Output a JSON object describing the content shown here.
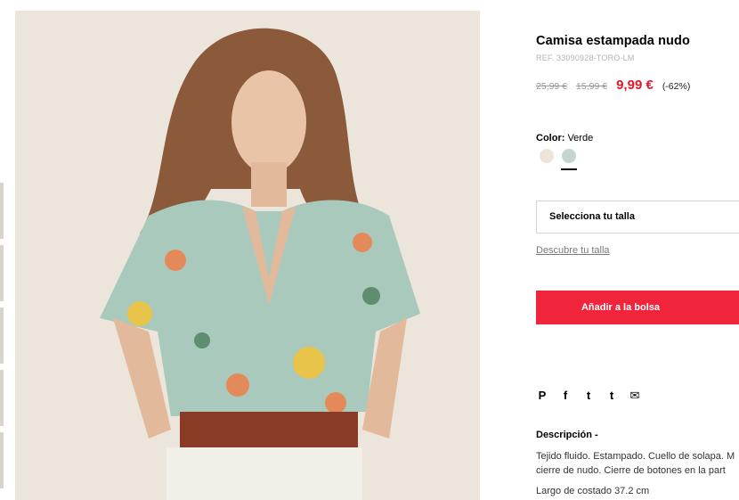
{
  "product": {
    "name": "Camisa estampada nudo",
    "ref": "REF. 33090928-TORO-LM",
    "price_original": "25,99 €",
    "price_previous": "15,99 €",
    "price_current": "9,99 €",
    "discount": "(-62%)"
  },
  "color": {
    "label": "Color:",
    "selected": "Verde",
    "swatches": [
      {
        "name": "crudo",
        "hex": "#efe4da"
      },
      {
        "name": "verde",
        "hex": "#c3d6d1",
        "selected": true
      }
    ]
  },
  "size": {
    "select_label": "Selecciona tu talla",
    "help_link": "Descubre tu talla"
  },
  "actions": {
    "add_to_bag": "Añadir a la bolsa"
  },
  "share": {
    "icons": [
      "pinterest-icon",
      "facebook-icon",
      "twitter-icon",
      "tumblr-icon",
      "email-icon"
    ],
    "glyphs": [
      "P",
      "f",
      "t",
      "t",
      "✉"
    ]
  },
  "description": {
    "title": "Descripción -",
    "line1": "Tejido fluido. Estampado. Cuello de solapa. M",
    "line2": "cierre de nudo. Cierre de botones en la part",
    "length": "Largo de costado 37.2 cm"
  },
  "colors": {
    "accent": "#f0253b",
    "price_sale": "#e0162b"
  }
}
